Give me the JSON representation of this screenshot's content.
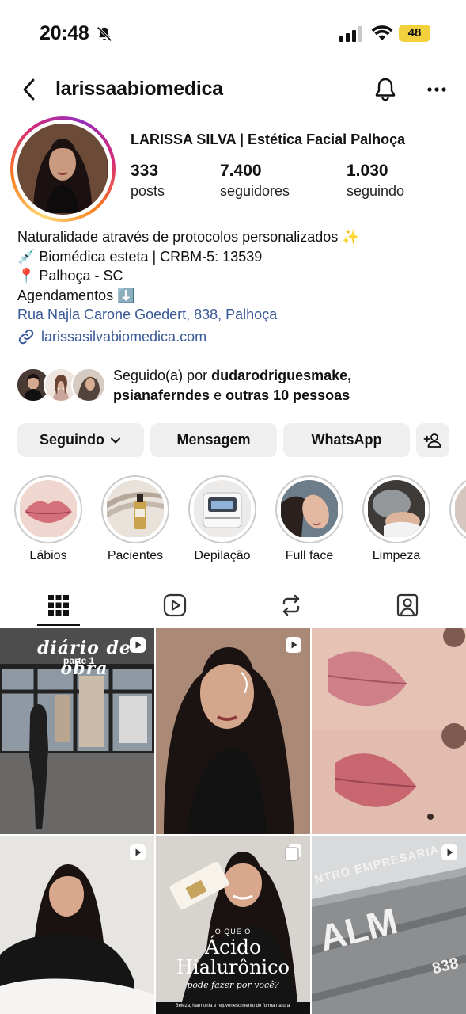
{
  "status_bar": {
    "time": "20:48",
    "battery": "48"
  },
  "header": {
    "username": "larissaabiomedica"
  },
  "profile": {
    "display_name": "LARISSA SILVA | Estética Facial Palhoça",
    "stats": [
      {
        "value": "333",
        "label": "posts"
      },
      {
        "value": "7.400",
        "label": "seguidores"
      },
      {
        "value": "1.030",
        "label": "seguindo"
      }
    ],
    "bio": [
      "Naturalidade através de protocolos personalizados ✨",
      "💉 Biomédica esteta | CRBM-5: 13539",
      "📍 Palhoça - SC",
      "Agendamentos ⬇️"
    ],
    "address": "Rua Najla Carone Goedert, 838, Palhoça",
    "website": "larissasilvabiomedica.com"
  },
  "followed_by": {
    "prefix": "Seguido(a) por",
    "user1": "dudarodriguesmake,",
    "user2": "psianaferndes",
    "connector": "e",
    "others": "outras 10 pessoas"
  },
  "buttons": {
    "following": "Seguindo",
    "message": "Mensagem",
    "whatsapp": "WhatsApp"
  },
  "highlights": [
    {
      "label": "Lábios"
    },
    {
      "label": "Pacientes"
    },
    {
      "label": "Depilação"
    },
    {
      "label": "Full face"
    },
    {
      "label": "Limpeza"
    }
  ],
  "posts": {
    "p1_title": "diário de obra",
    "p1_subtitle": "parte 1",
    "p5_line1": "O QUE O",
    "p5_line2": "Ácido",
    "p5_line3": "Hialurônico",
    "p5_line4": "pode fazer por você?",
    "p5_line5": "Beleza, harmonia e rejuvenescimento de forma natural",
    "p6_sign1": "NTRO EMPRESARIA",
    "p6_sign2": "ALM",
    "p6_sign3": "838"
  },
  "colors": {
    "link": "#385898",
    "button_bg": "#efefef",
    "battery": "#f3d03e"
  }
}
